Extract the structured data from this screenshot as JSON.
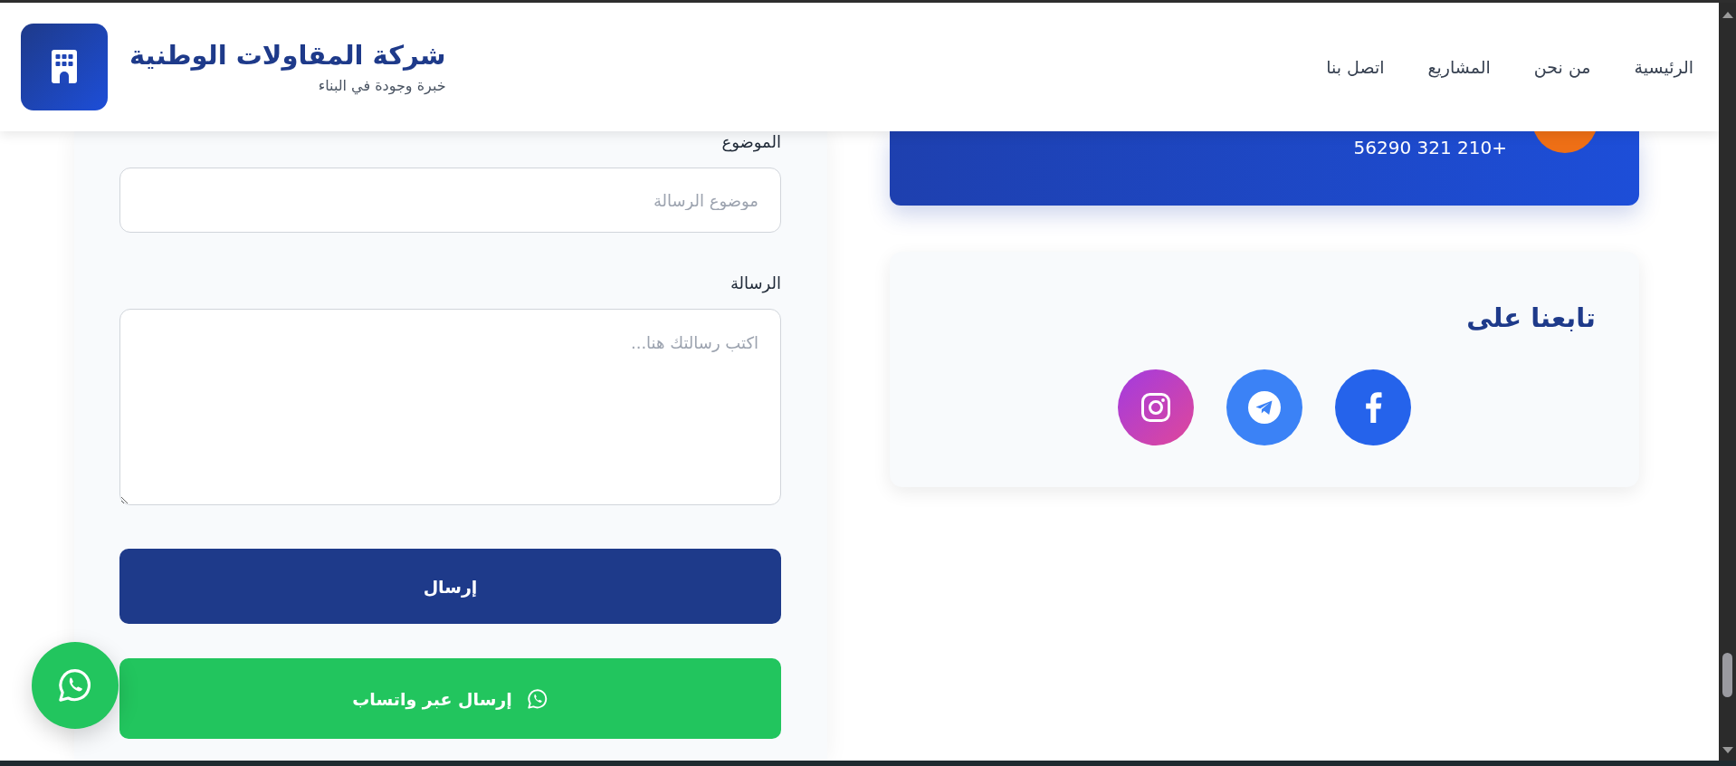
{
  "header": {
    "brand": {
      "title": "شركة المقاولات الوطنية",
      "tagline": "خبرة وجودة في البناء"
    },
    "nav": [
      "الرئيسية",
      "من نحن",
      "المشاريع",
      "اتصل بنا"
    ]
  },
  "contact_card": {
    "phone": "+210 321 56290"
  },
  "social": {
    "title": "تابعنا على"
  },
  "form": {
    "fields": [
      {
        "kind": "input",
        "label": "الموضوع",
        "placeholder": "موضوع الرسالة"
      },
      {
        "kind": "textarea",
        "label": "الرسالة",
        "placeholder": "اكتب رسالتك هنا..."
      }
    ],
    "buttons": [
      {
        "kind": "submit",
        "label": "إرسال"
      },
      {
        "kind": "whatsapp",
        "label": "إرسال عبر واتساب"
      }
    ]
  }
}
